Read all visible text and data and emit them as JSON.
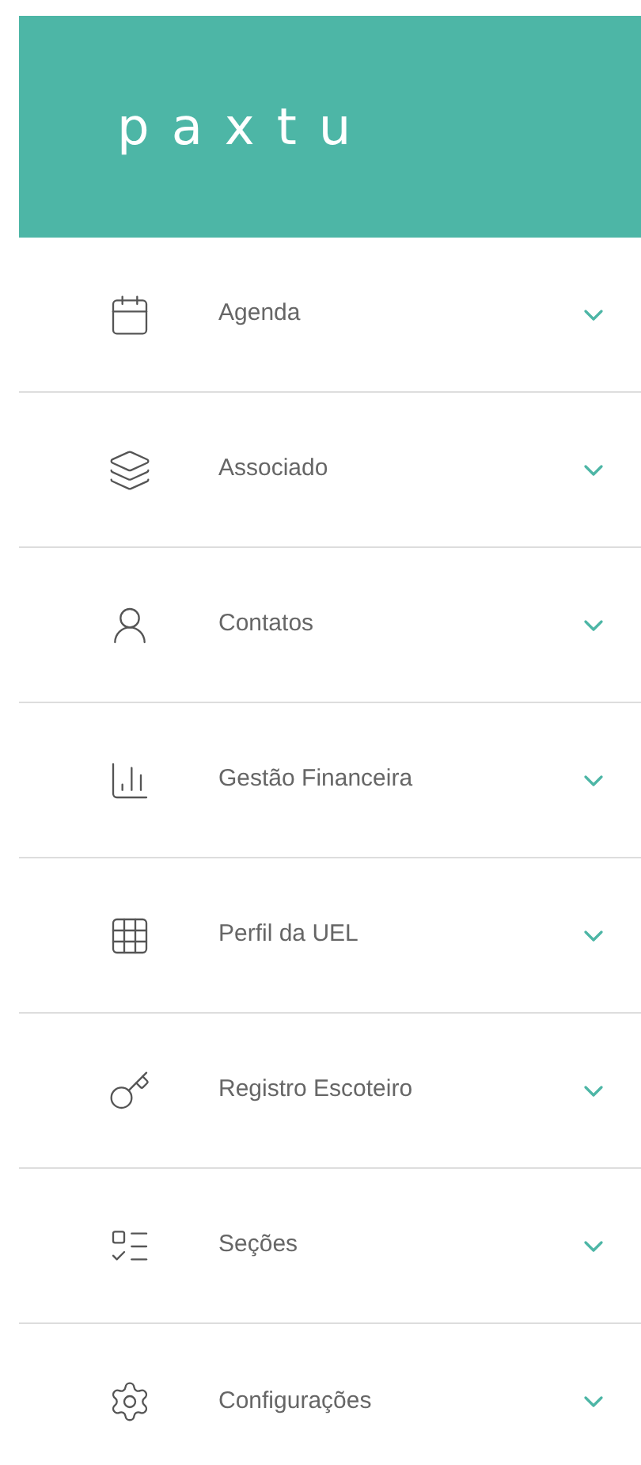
{
  "logo": "paxtu",
  "menu": [
    {
      "label": "Agenda",
      "kind": "calendar",
      "expanded": false
    },
    {
      "label": "Associado",
      "kind": "layers",
      "expanded": false
    },
    {
      "label": "Contatos",
      "kind": "person",
      "expanded": false
    },
    {
      "label": "Gestão Financeira",
      "kind": "bars",
      "expanded": false
    },
    {
      "label": "Perfil da UEL",
      "kind": "grid",
      "expanded": false
    },
    {
      "label": "Registro Escoteiro",
      "kind": "key",
      "expanded": false
    },
    {
      "label": "Seções",
      "kind": "list",
      "expanded": false
    },
    {
      "label": "Configurações",
      "kind": "gear",
      "expanded": false
    }
  ]
}
